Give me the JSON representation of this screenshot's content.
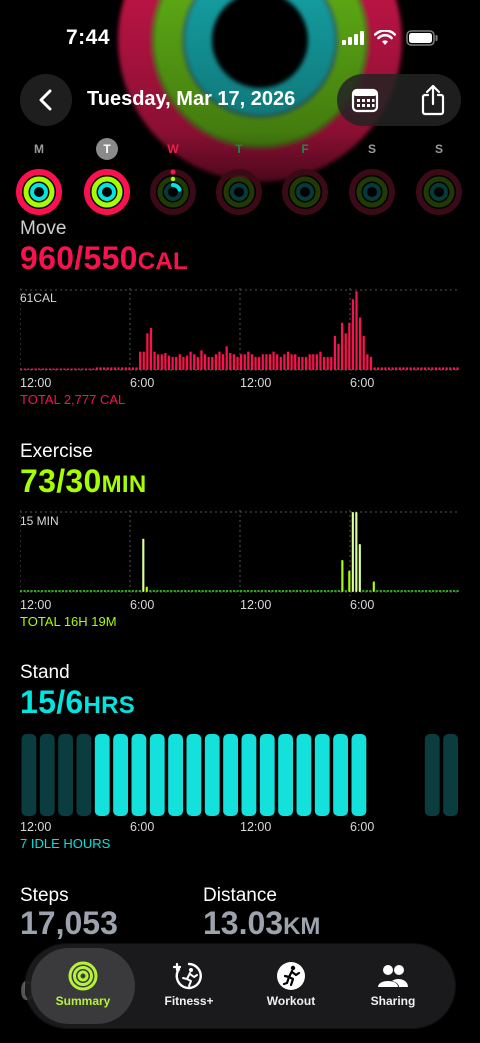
{
  "status": {
    "time": "7:44"
  },
  "header": {
    "date": "Tuesday, Mar 17, 2026"
  },
  "colors": {
    "move": "#fa114f",
    "exercise": "#a6ff00",
    "stand": "#00e5e0",
    "tab_active": "#b6f23a"
  },
  "week": [
    {
      "label": "M",
      "state": "past",
      "move": 1.0,
      "exercise": 1.0,
      "stand": 1.0
    },
    {
      "label": "T",
      "state": "today",
      "move": 1.0,
      "exercise": 1.0,
      "stand": 1.0
    },
    {
      "label": "W",
      "state": "selected",
      "move": 0.0,
      "exercise": 0.0,
      "stand": 0.3
    },
    {
      "label": "T",
      "state": "future",
      "move": 0,
      "exercise": 0,
      "stand": 0
    },
    {
      "label": "F",
      "state": "future",
      "move": 0,
      "exercise": 0,
      "stand": 0
    },
    {
      "label": "S",
      "state": "future",
      "move": 0,
      "exercise": 0,
      "stand": 0
    },
    {
      "label": "S",
      "state": "future",
      "move": 0,
      "exercise": 0,
      "stand": 0
    }
  ],
  "move": {
    "title": "Move",
    "value": "960/550",
    "unit": "CAL",
    "ymax_label": "61CAL",
    "total": "TOTAL 2,777 CAL",
    "x_ticks": [
      "12:00",
      "6:00",
      "12:00",
      "6:00"
    ]
  },
  "exercise": {
    "title": "Exercise",
    "value": "73/30",
    "unit": "MIN",
    "ymax_label": "15 MIN",
    "total": "TOTAL 16H 19M",
    "x_ticks": [
      "12:00",
      "6:00",
      "12:00",
      "6:00"
    ]
  },
  "stand": {
    "title": "Stand",
    "value": "15/6",
    "unit": "HRS",
    "total": "7 IDLE HOURS",
    "x_ticks": [
      "12:00",
      "6:00",
      "12:00",
      "6:00"
    ]
  },
  "stats": {
    "steps_label": "Steps",
    "steps_value": "17,053",
    "distance_label": "Distance",
    "distance_value": "13.03",
    "distance_unit": "KM"
  },
  "chart_data": [
    {
      "type": "bar",
      "title": "Move",
      "ylabel": "61CAL",
      "x_ticks": [
        "12:00",
        "6:00",
        "12:00",
        "6:00"
      ],
      "values": [
        0,
        0,
        0,
        0,
        0,
        0,
        0,
        0,
        0,
        0,
        0,
        0,
        0,
        0,
        0,
        0,
        0,
        0,
        0,
        0,
        0,
        2,
        2,
        2,
        2,
        2,
        2,
        2,
        2,
        2,
        2,
        2,
        2,
        14,
        14,
        28,
        32,
        14,
        12,
        12,
        13,
        11,
        10,
        10,
        12,
        10,
        11,
        14,
        12,
        10,
        15,
        12,
        10,
        10,
        12,
        14,
        12,
        18,
        13,
        12,
        10,
        12,
        12,
        14,
        12,
        10,
        10,
        12,
        12,
        12,
        14,
        12,
        10,
        12,
        14,
        12,
        12,
        10,
        10,
        10,
        12,
        12,
        12,
        14,
        10,
        10,
        10,
        26,
        20,
        36,
        28,
        36,
        54,
        60,
        40,
        26,
        12,
        10,
        2,
        2,
        2,
        2,
        2,
        2,
        2,
        2,
        2,
        2,
        2,
        2,
        2,
        2,
        2,
        2,
        2,
        2,
        2,
        2,
        2,
        2,
        2,
        2
      ]
    },
    {
      "type": "bar",
      "title": "Exercise",
      "ylabel": "15 MIN",
      "x_ticks": [
        "12:00",
        "6:00",
        "12:00",
        "6:00"
      ],
      "values": [
        0,
        0,
        0,
        0,
        0,
        0,
        0,
        0,
        0,
        0,
        0,
        0,
        0,
        0,
        0,
        0,
        0,
        0,
        0,
        0,
        0,
        0,
        0,
        0,
        0,
        0,
        0,
        0,
        0,
        0,
        0,
        0,
        0,
        0,
        0,
        10,
        1,
        0,
        0,
        0,
        0,
        0,
        0,
        0,
        0,
        0,
        0,
        0,
        0,
        0,
        0,
        0,
        0,
        0,
        0,
        0,
        0,
        0,
        0,
        0,
        0,
        0,
        0,
        0,
        0,
        0,
        0,
        0,
        0,
        0,
        0,
        0,
        0,
        0,
        0,
        0,
        0,
        0,
        0,
        0,
        0,
        0,
        0,
        0,
        0,
        0,
        0,
        0,
        0,
        0,
        0,
        0,
        6,
        0,
        4,
        15,
        15,
        9,
        0,
        0,
        0,
        2,
        0,
        0,
        0,
        0,
        0,
        0,
        0,
        0,
        0,
        0,
        0,
        0,
        0,
        0,
        0,
        0,
        0,
        0,
        0,
        0,
        0,
        0,
        0,
        0
      ]
    },
    {
      "type": "bar",
      "title": "Stand",
      "x_ticks": [
        "12:00",
        "6:00",
        "12:00",
        "6:00"
      ],
      "values": [
        1,
        1,
        1,
        1,
        1,
        1,
        1,
        1,
        1,
        1,
        1,
        1,
        1,
        1,
        1,
        1,
        1,
        1,
        1,
        0,
        0,
        0,
        1,
        1,
        1,
        0
      ],
      "stood": [
        false,
        false,
        false,
        false,
        true,
        true,
        true,
        true,
        true,
        true,
        true,
        true,
        true,
        true,
        true,
        true,
        true,
        true,
        true,
        false,
        false,
        false,
        false,
        false,
        false,
        false
      ]
    }
  ],
  "tabs": [
    {
      "label": "Summary",
      "icon": "summary-rings-icon",
      "active": true
    },
    {
      "label": "Fitness+",
      "icon": "fitness-plus-icon",
      "active": false
    },
    {
      "label": "Workout",
      "icon": "workout-runner-icon",
      "active": false
    },
    {
      "label": "Sharing",
      "icon": "sharing-people-icon",
      "active": false
    }
  ],
  "faded_footer": "0"
}
